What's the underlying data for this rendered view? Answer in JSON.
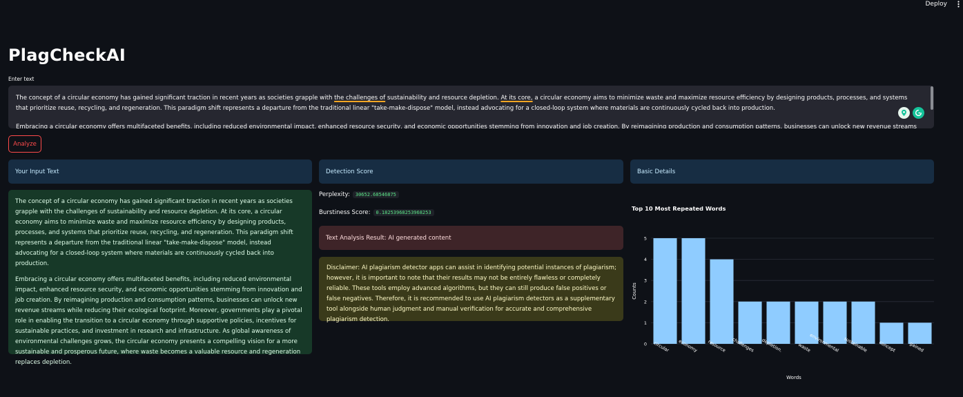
{
  "topbar": {
    "deploy_label": "Deploy",
    "menu_icon": "kebab-menu-icon"
  },
  "app": {
    "title": "PlagCheckAI"
  },
  "input": {
    "label": "Enter text",
    "paragraph1": {
      "before": "The concept of a circular economy has gained significant traction in recent years as societies grapple with ",
      "underline1": "the challenges of",
      "middle": " sustainability and resource depletion. ",
      "underline2": "At its core,",
      "after": " a circular economy aims to minimize waste and maximize resource efficiency by designing products, processes, and systems that prioritize reuse, recycling, and regeneration. This paradigm shift represents a departure from the traditional linear \"take-make-dispose\" model, instead advocating for a closed-loop system where materials are continuously cycled back into production."
    },
    "paragraph2": "Embracing a circular economy offers multifaceted benefits, including reduced environmental impact, enhanced resource security, and economic opportunities stemming from innovation and job creation. By reimagining production and consumption patterns, businesses can unlock new revenue streams while reducing"
  },
  "analyze_button": {
    "label": "Analyze"
  },
  "columns": {
    "input_header": "Your Input Text",
    "detection_header": "Detection Score",
    "details_header": "Basic Details"
  },
  "input_display": {
    "paragraph1": "The concept of a circular economy has gained significant traction in recent years as societies grapple with the challenges of sustainability and resource depletion. At its core, a circular economy aims to minimize waste and maximize resource efficiency by designing products, processes, and systems that prioritize reuse, recycling, and regeneration. This paradigm shift represents a departure from the traditional linear \"take-make-dispose\" model, instead advocating for a closed-loop system where materials are continuously cycled back into production.",
    "paragraph2": "Embracing a circular economy offers multifaceted benefits, including reduced environmental impact, enhanced resource security, and economic opportunities stemming from innovation and job creation. By reimagining production and consumption patterns, businesses can unlock new revenue streams while reducing their ecological footprint. Moreover, governments play a pivotal role in enabling the transition to a circular economy through supportive policies, incentives for sustainable practices, and investment in research and infrastructure. As global awareness of environmental challenges grows, the circular economy presents a compelling vision for a more sustainable and prosperous future, where waste becomes a valuable resource and regeneration replaces depletion."
  },
  "detection": {
    "perplexity_label": "Perplexity:",
    "perplexity_value": "30652.68546875",
    "burstiness_label": "Burstiness Score:",
    "burstiness_value": "0.18253968253968253",
    "result": "Text Analysis Result: AI generated content",
    "disclaimer": "Disclaimer: AI plagiarism detector apps can assist in identifying potential instances of plagiarism; however, it is important to note that their results may not be entirely flawless or completely reliable. These tools employ advanced algorithms, but they can still produce false positives or false negatives. Therefore, it is recommended to use AI plagiarism detectors as a supplementary tool alongside human judgment and manual verification for accurate and comprehensive plagiarism detection."
  },
  "colors": {
    "accent": "#ff4b4b",
    "bar": "#8fccff",
    "header_bg": "#172d43",
    "success_bg": "#173928",
    "error_bg": "#3e2428",
    "warning_bg": "#3a3a1a"
  },
  "chart_data": {
    "type": "bar",
    "title": "Top 10 Most Repeated Words",
    "xlabel": "Words",
    "ylabel": "Counts",
    "categories": [
      "circular",
      "economy",
      "resource",
      "challenges",
      "depletion.",
      "waste",
      "environmental",
      "sustainable",
      "concept",
      "gained"
    ],
    "values": [
      5,
      5,
      4,
      2,
      2,
      2,
      2,
      2,
      1,
      1
    ],
    "ylim": [
      0,
      5
    ],
    "yticks": [
      0,
      1,
      2,
      3,
      4,
      5
    ],
    "grid": true
  }
}
